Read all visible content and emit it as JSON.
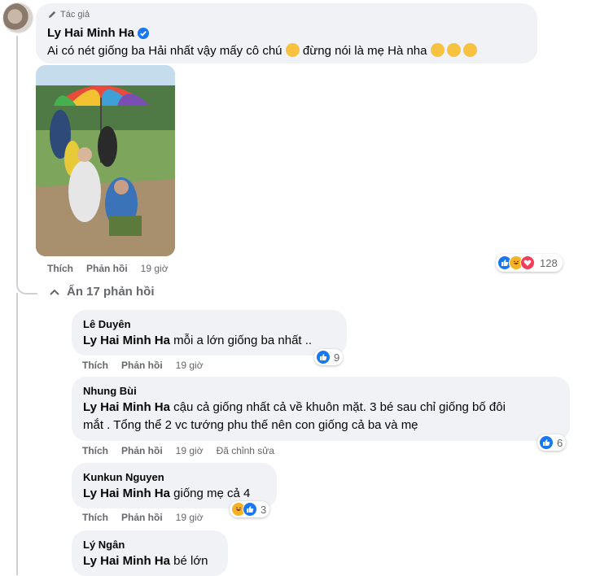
{
  "main_comment": {
    "badge": "Tác giả",
    "author": "Ly Hai Minh Ha",
    "text": "Ai có nét giống ba Hải nhất vậy mấy cô chú",
    "text2": "đừng nói là mẹ Hà nha",
    "actions": {
      "like": "Thích",
      "reply": "Phản hồi",
      "time": "19 giờ"
    },
    "reaction_count": "128"
  },
  "toggle_replies": "Ẩn 17 phản hồi",
  "replies": [
    {
      "author": "Lê Duyên",
      "mention": "Ly Hai Minh Ha",
      "text": "mỗi a lớn giống ba nhất ..",
      "actions": {
        "like": "Thích",
        "reply": "Phản hồi",
        "time": "19 giờ"
      },
      "reaction_count": "9"
    },
    {
      "author": "Nhung Bùi",
      "mention": "Ly Hai Minh Ha",
      "text": "cậu cả giống nhất cả về khuôn mặt. 3 bé sau chỉ giống bố đôi",
      "text2": "mắt . Tổng thể 2 vc tướng phu thế nên con giống cả ba và mẹ",
      "actions": {
        "like": "Thích",
        "reply": "Phản hồi",
        "time": "19 giờ",
        "edited": "Đã chỉnh sửa"
      },
      "reaction_count": "6"
    },
    {
      "author": "Kunkun Nguyen",
      "mention": "Ly Hai Minh Ha",
      "text": "giống mẹ cả 4",
      "actions": {
        "like": "Thích",
        "reply": "Phản hồi",
        "time": "19 giờ"
      },
      "reaction_count": "3"
    },
    {
      "author": "Lý Ngân",
      "mention": "Ly Hai Minh Ha",
      "text": "bé lớn"
    }
  ]
}
